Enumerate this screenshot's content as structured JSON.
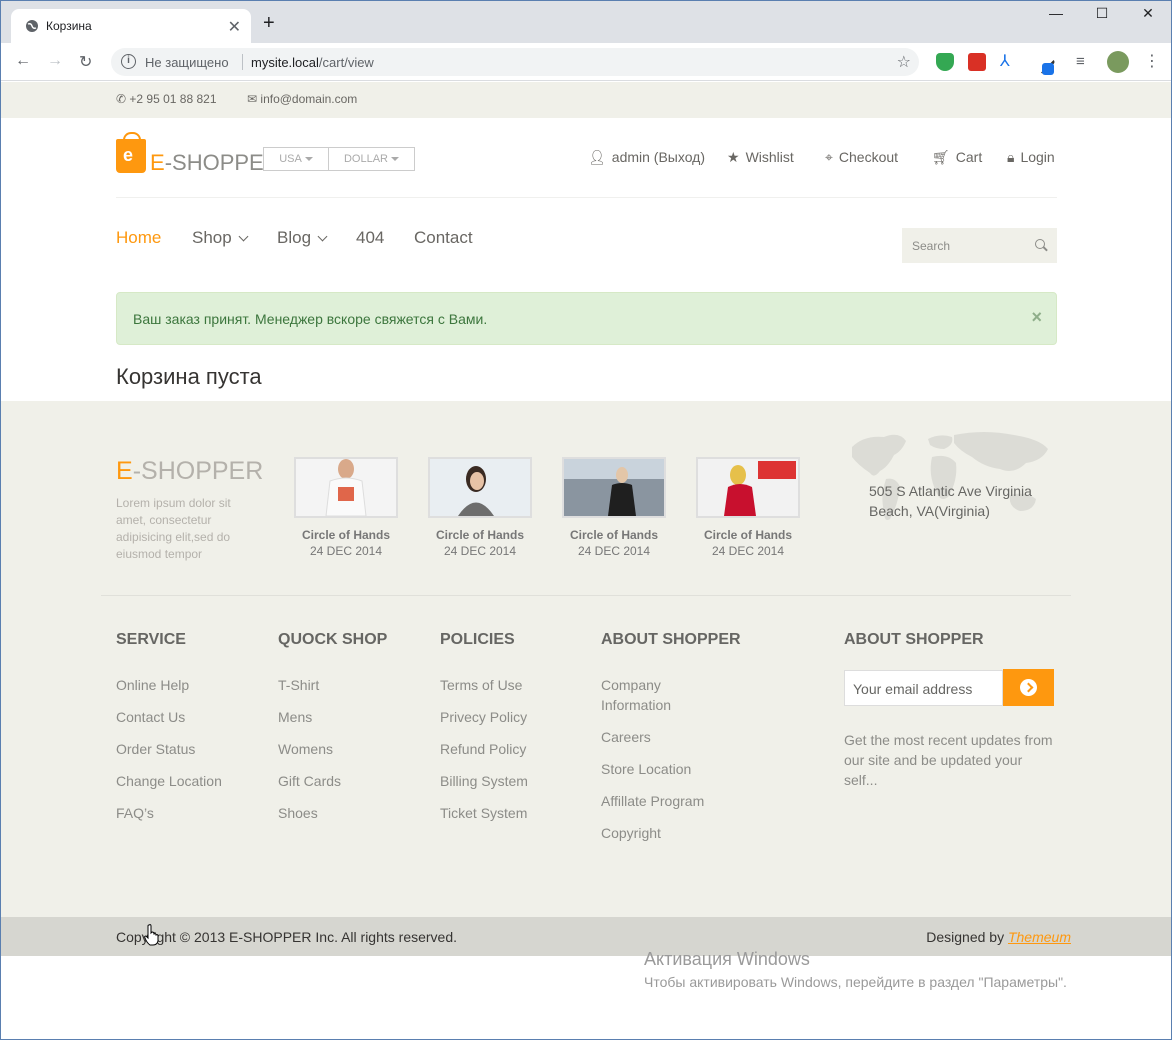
{
  "browser": {
    "tab_title": "Корзина",
    "insecure_label": "Не защищено",
    "url_host": "mysite.local",
    "url_path": "/cart/view"
  },
  "topbar": {
    "phone": "+2 95 01 88 821",
    "email": "info@domain.com"
  },
  "header": {
    "logo_e": "E",
    "logo_rest": "-SHOPPER",
    "country_dropdown": "USA",
    "currency_dropdown": "DOLLAR",
    "user_menu": [
      {
        "label": "admin (Выход)",
        "icon": "user-icon"
      },
      {
        "label": "Wishlist",
        "icon": "star-icon"
      },
      {
        "label": "Checkout",
        "icon": "crosshairs-icon"
      },
      {
        "label": "Cart",
        "icon": "cart-icon"
      },
      {
        "label": "Login",
        "icon": "lock-icon"
      }
    ]
  },
  "nav": {
    "items": [
      "Home",
      "Shop",
      "Blog",
      "404",
      "Contact"
    ],
    "active": "Home",
    "search_placeholder": "Search"
  },
  "alert": {
    "message": "Ваш заказ принят. Менеджер вскоре свяжется с Вами.",
    "close": "×"
  },
  "cart": {
    "title": "Корзина пуста"
  },
  "footer": {
    "logo_e": "E",
    "logo_rest": "-SHOPPER",
    "description": "Lorem ipsum dolor sit amet, consectetur adipisicing elit,sed do eiusmod tempor",
    "videos": [
      {
        "caption": "Circle of Hands",
        "date": "24 DEC 2014"
      },
      {
        "caption": "Circle of Hands",
        "date": "24 DEC 2014"
      },
      {
        "caption": "Circle of Hands",
        "date": "24 DEC 2014"
      },
      {
        "caption": "Circle of Hands",
        "date": "24 DEC 2014"
      }
    ],
    "address": "505 S Atlantic Ave Virginia Beach, VA(Virginia)",
    "columns": [
      {
        "title": "SERVICE",
        "links": [
          "Online Help",
          "Contact Us",
          "Order Status",
          "Change Location",
          "FAQ’s"
        ]
      },
      {
        "title": "QUOCK SHOP",
        "links": [
          "T-Shirt",
          "Mens",
          "Womens",
          "Gift Cards",
          "Shoes"
        ]
      },
      {
        "title": "POLICIES",
        "links": [
          "Terms of Use",
          "Privecy Policy",
          "Refund Policy",
          "Billing System",
          "Ticket System"
        ]
      },
      {
        "title": "ABOUT SHOPPER",
        "links": [
          "Company Information",
          "Careers",
          "Store Location",
          "Affillate Program",
          "Copyright"
        ]
      }
    ],
    "subscribe": {
      "title": "ABOUT SHOPPER",
      "placeholder": "Your email address",
      "note": "Get the most recent updates from our site and be updated your self..."
    },
    "copyright": "Copyright © 2013 E-SHOPPER Inc. All rights reserved.",
    "designed_by": "Designed by",
    "designer": "Themeum"
  },
  "windows_watermark": {
    "title": "Активация Windows",
    "subtitle": "Чтобы активировать Windows, перейдите в раздел \"Параметры\"."
  },
  "colors": {
    "accent": "#fe980f",
    "footer_bg": "#f0f0e9",
    "alert_bg": "#dff0d8"
  }
}
